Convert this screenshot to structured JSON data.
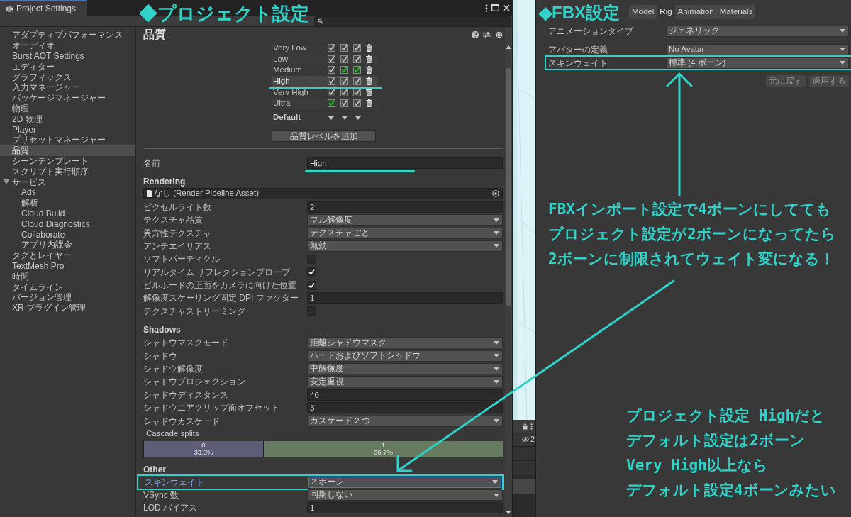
{
  "window": {
    "title": "Project Settings"
  },
  "sidebar": {
    "items": [
      {
        "label": "アダプティブパフォーマンス",
        "selected": false
      },
      {
        "label": "オーディオ",
        "selected": false
      },
      {
        "label": "Burst AOT Settings",
        "selected": false
      },
      {
        "label": "エディター",
        "selected": false
      },
      {
        "label": "グラフィックス",
        "selected": false
      },
      {
        "label": "入力マネージャー",
        "selected": false
      },
      {
        "label": "パッケージマネージャー",
        "selected": false
      },
      {
        "label": "物理",
        "selected": false
      },
      {
        "label": "2D 物理",
        "selected": false
      },
      {
        "label": "Player",
        "selected": false
      },
      {
        "label": "プリセットマネージャー",
        "selected": false
      },
      {
        "label": "品質",
        "selected": true
      },
      {
        "label": "シーンテンプレート",
        "selected": false
      },
      {
        "label": "スクリプト実行順序",
        "selected": false
      },
      {
        "label": "サービス",
        "selected": false,
        "expanded": true,
        "children": [
          {
            "label": "Ads",
            "selected": false
          },
          {
            "label": "解析",
            "selected": false
          },
          {
            "label": "Cloud Build",
            "selected": false
          },
          {
            "label": "Cloud Diagnostics",
            "selected": false
          },
          {
            "label": "Collaborate",
            "selected": false
          },
          {
            "label": "アプリ内課金",
            "selected": false
          }
        ]
      },
      {
        "label": "タグとレイヤー",
        "selected": false
      },
      {
        "label": "TextMesh Pro",
        "selected": false
      },
      {
        "label": "時間",
        "selected": false
      },
      {
        "label": "タイムライン",
        "selected": false
      },
      {
        "label": "バージョン管理",
        "selected": false
      },
      {
        "label": "XR プラグイン管理",
        "selected": false
      }
    ]
  },
  "quality": {
    "title": "品質",
    "levels": [
      {
        "name": "Very Low",
        "selected": false,
        "platforms": [
          {
            "checked": true,
            "default": false
          },
          {
            "checked": true,
            "default": false
          },
          {
            "checked": true,
            "default": false
          }
        ]
      },
      {
        "name": "Low",
        "selected": false,
        "platforms": [
          {
            "checked": true,
            "default": false
          },
          {
            "checked": true,
            "default": false
          },
          {
            "checked": true,
            "default": false
          }
        ]
      },
      {
        "name": "Medium",
        "selected": false,
        "platforms": [
          {
            "checked": true,
            "default": false
          },
          {
            "checked": true,
            "default": true
          },
          {
            "checked": true,
            "default": true
          }
        ]
      },
      {
        "name": "High",
        "selected": true,
        "underlined": true,
        "platforms": [
          {
            "checked": true,
            "default": false
          },
          {
            "checked": true,
            "default": false
          },
          {
            "checked": true,
            "default": false
          }
        ]
      },
      {
        "name": "Very High",
        "selected": false,
        "platforms": [
          {
            "checked": true,
            "default": false
          },
          {
            "checked": true,
            "default": false
          },
          {
            "checked": true,
            "default": false
          }
        ]
      },
      {
        "name": "Ultra",
        "selected": false,
        "platforms": [
          {
            "checked": true,
            "default": true
          },
          {
            "checked": true,
            "default": false
          },
          {
            "checked": true,
            "default": false
          }
        ]
      }
    ],
    "default_label": "Default",
    "add_button": "品質レベルを追加"
  },
  "name_field": {
    "label": "名前",
    "value": "High",
    "underlined": true
  },
  "sections": [
    {
      "heading": "Rendering",
      "rows": [
        {
          "kind": "asset",
          "value": "なし (Render Pipeline Asset)"
        },
        {
          "kind": "text",
          "label": "ピクセルライト数",
          "value": "2"
        },
        {
          "kind": "dropdown",
          "label": "テクスチャ品質",
          "value": "フル解像度"
        },
        {
          "kind": "dropdown",
          "label": "異方性テクスチャ",
          "value": "テクスチャごと"
        },
        {
          "kind": "dropdown",
          "label": "アンチエイリアス",
          "value": "無効"
        },
        {
          "kind": "checkbox",
          "label": "ソフトパーティクル",
          "checked": false
        },
        {
          "kind": "checkbox",
          "label": "リアルタイム リフレクションプローブ",
          "checked": true
        },
        {
          "kind": "checkbox",
          "label": "ビルボードの正面をカメラに向けた位置",
          "checked": true
        },
        {
          "kind": "text",
          "label": "解像度スケーリング固定 DPI ファクター",
          "value": "1"
        },
        {
          "kind": "checkbox",
          "label": "テクスチャストリーミング",
          "checked": false
        }
      ]
    },
    {
      "heading": "Shadows",
      "rows": [
        {
          "kind": "dropdown",
          "label": "シャドウマスクモード",
          "value": "距離シャドウマスク"
        },
        {
          "kind": "dropdown",
          "label": "シャドウ",
          "value": "ハードおよびソフトシャドウ"
        },
        {
          "kind": "dropdown",
          "label": "シャドウ解像度",
          "value": "中解像度"
        },
        {
          "kind": "dropdown",
          "label": "シャドウプロジェクション",
          "value": "安定重視"
        },
        {
          "kind": "text",
          "label": "シャドウディスタンス",
          "value": "40"
        },
        {
          "kind": "text",
          "label": "シャドウニアクリップ面オフセット",
          "value": "3"
        },
        {
          "kind": "dropdown",
          "label": "シャドウカスケード",
          "value": "カスケード 2 つ"
        },
        {
          "kind": "splits",
          "label": "Cascade splits",
          "splits": [
            {
              "index": "0",
              "percent": "33.3%",
              "level": 0.333,
              "color": "#5d5d78"
            },
            {
              "index": "1",
              "percent": "66.7%",
              "level": 0.667,
              "color": "#657a5e"
            }
          ]
        }
      ]
    },
    {
      "heading": "Other",
      "rows": [
        {
          "kind": "dropdown",
          "label": "スキンウェイト",
          "value": "2 ボーン",
          "focused": true,
          "highlighted": true
        },
        {
          "kind": "dropdown",
          "label": "VSync 数",
          "value": "同期しない"
        },
        {
          "kind": "text",
          "label": "LOD バイアス",
          "value": "1"
        }
      ]
    }
  ],
  "scene_strip": {
    "count": "2"
  },
  "fbx": {
    "tabs": [
      {
        "label": "Model",
        "selected": false
      },
      {
        "label": "Rig",
        "selected": true
      },
      {
        "label": "Animation",
        "selected": false
      },
      {
        "label": "Materials",
        "selected": false
      }
    ],
    "rows": [
      {
        "label": "アニメーションタイプ",
        "value": "ジェネリック"
      },
      {
        "label": "アバターの定義",
        "value": "No Avatar"
      },
      {
        "label": "スキンウェイト",
        "value": "標準 (4 ボーン)",
        "highlighted": true
      }
    ],
    "buttons": [
      "元に戻す",
      "適用する"
    ]
  },
  "annotations": {
    "project_title": "◆プロジェクト設定",
    "fbx_title": "◆FBX設定",
    "main_note": [
      "FBXインポート設定で4ボーンにしてても",
      "プロジェクト設定が2ボーンになってたら",
      "2ボーンに制限されてウェイト変になる！"
    ],
    "sub_note": [
      "プロジェクト設定 Highだと",
      "デフォルト設定は2ボーン",
      "Very High以上なら",
      "デフォルト設定4ボーンみたい"
    ]
  }
}
